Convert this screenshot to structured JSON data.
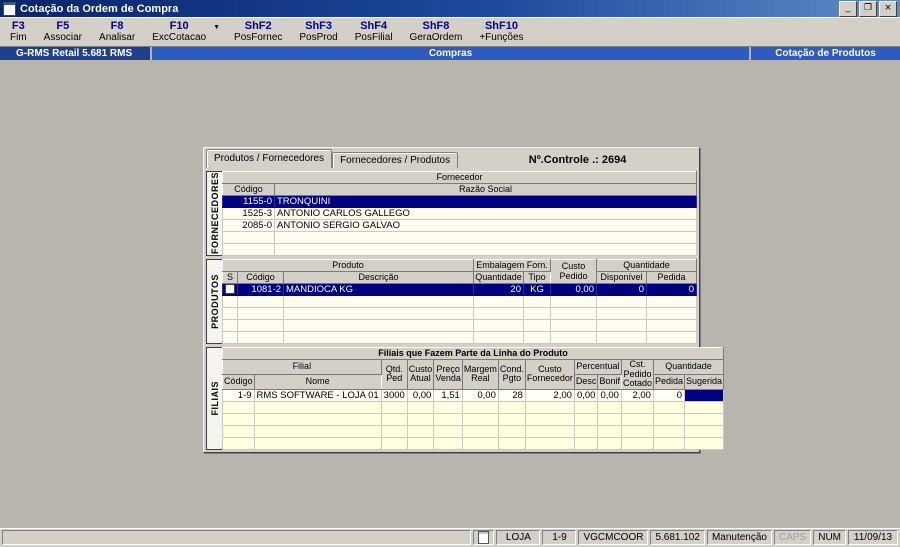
{
  "colors": {
    "titlebar_blue": "#0a246a",
    "band_left_blue": "#1f3f8f",
    "band_blue": "#2d5bbf",
    "selection_navy": "#000080",
    "chrome_gray": "#d4d0c8"
  },
  "window": {
    "title": "Cotação da Ordem de Compra",
    "minimize": "_",
    "restore": "❐",
    "close": "×"
  },
  "toolbar": {
    "dropdown_glyph": "▼",
    "items": [
      {
        "key": "F3",
        "label": "Fim"
      },
      {
        "key": "F5",
        "label": "Associar"
      },
      {
        "key": "F8",
        "label": "Analisar"
      },
      {
        "key": "F10",
        "label": "ExcCotacao"
      },
      {
        "key": "ShF2",
        "label": "PosFornec"
      },
      {
        "key": "ShF3",
        "label": "PosProd"
      },
      {
        "key": "ShF4",
        "label": "PosFilial"
      },
      {
        "key": "ShF8",
        "label": "GeraOrdem"
      },
      {
        "key": "ShF10",
        "label": "+Funções"
      }
    ]
  },
  "header": {
    "app": "G-RMS Retail 5.681 RMS",
    "module": "Compras",
    "screen": "Cotação de Produtos"
  },
  "panel": {
    "tab_produtos_fornecedores": "Produtos / Fornecedores",
    "tab_fornecedores_produtos": "Fornecedores / Produtos",
    "control": "Nº.Controle .: 2694"
  },
  "fornecedores": {
    "label": "FORNECEDORES",
    "group": "Fornecedor",
    "col_codigo": "Código",
    "col_razao": "Razão Social",
    "rows": [
      {
        "codigo": "1155-0",
        "razao": "TRONQUINI"
      },
      {
        "codigo": "1525-3",
        "razao": "ANTONIO CARLOS GALLEGO"
      },
      {
        "codigo": "2085-0",
        "razao": "ANTONIO SERGIO GALVAO"
      }
    ]
  },
  "produtos": {
    "label": "PRODUTOS",
    "group_produto": "Produto",
    "group_embalagem": "Embalagem Forn.",
    "group_quantidade": "Quantidade",
    "col_s": "S",
    "col_codigo": "Código",
    "col_descricao": "Descrição",
    "col_quantidade": "Quantidade",
    "col_tipo": "Tipo",
    "col_custo_pedido": "Custo Pedido",
    "col_disponivel": "Disponível",
    "col_pedida": "Pedida",
    "row": {
      "codigo": "1081-2",
      "descricao": "MANDIOCA KG",
      "quantidade": "20",
      "tipo": "KG",
      "custo_pedido": "0,00",
      "disponivel": "0",
      "pedida": "0"
    }
  },
  "filiais": {
    "label": "FILIAIS",
    "title": "Filiais que Fazem Parte da Linha do Produto",
    "group_filial": "Filial",
    "group_percentual": "Percentual",
    "group_quantidade": "Quantidade",
    "col_codigo": "Código",
    "col_nome": "Nome",
    "col_qtd_ped": "Qtd. Ped",
    "col_custo_atual": "Custo Atual",
    "col_preco_venda": "Preço Venda",
    "col_margem_real": "Margem Real",
    "col_cond_pgto": "Cond. Pgto",
    "col_custo_fornecedor": "Custo Fornecedor",
    "col_desc": "Desc",
    "col_bonif": "Bonif",
    "col_cst_pedido_cotado": "Cst. Pedido Cotado",
    "col_pedida": "Pedida",
    "col_sugerida": "Sugerida",
    "row": {
      "codigo": "1-9",
      "nome": "RMS SOFTWARE - LOJA 01",
      "qtd_ped": "3000",
      "custo_atual": "0,00",
      "preco_venda": "1,51",
      "margem_real": "0,00",
      "cond_pgto": "28",
      "custo_fornecedor": "2,00",
      "desc": "0,00",
      "bonif": "0,00",
      "cst_pedido_cotado": "2,00",
      "pedida": "0",
      "sugerida": ""
    }
  },
  "statusbar": {
    "loja": "LOJA",
    "filial": "1-9",
    "usuario": "VGCMCOOR",
    "versao": "5.681.102",
    "modo": "Manutenção",
    "caps": "CAPS",
    "num": "NUM",
    "data": "11/09/13"
  }
}
